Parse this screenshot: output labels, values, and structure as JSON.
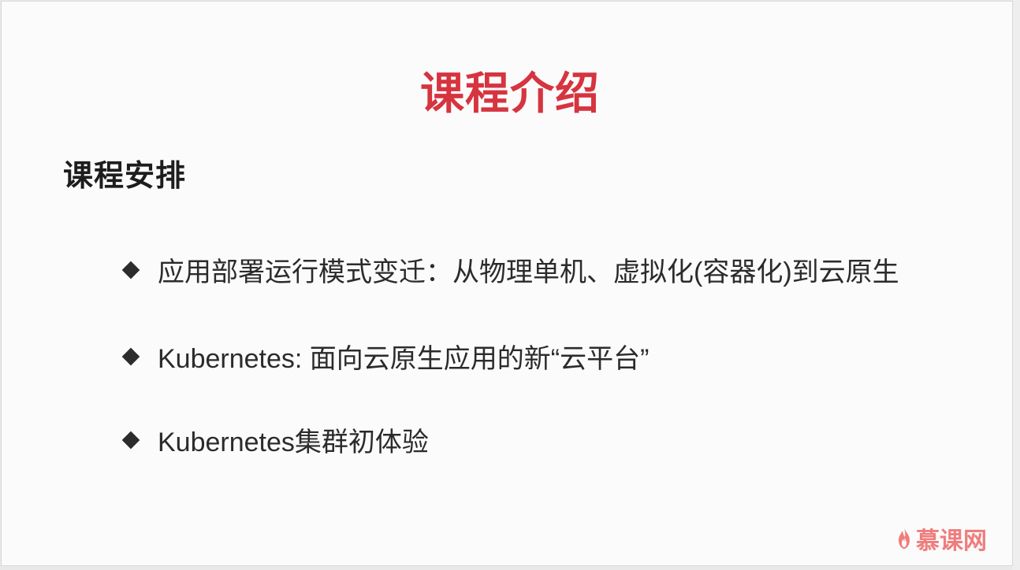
{
  "slide": {
    "title": "课程介绍",
    "section_title": "课程安排",
    "bullets": [
      "应用部署运行模式变迁：从物理单机、虚拟化(容器化)到云原生",
      "Kubernetes: 面向云原生应用的新“云平台”",
      "Kubernetes集群初体验"
    ]
  },
  "brand": {
    "name": "慕课网",
    "accent_color": "#f07d7d"
  },
  "colors": {
    "title": "#d6343f",
    "text": "#2b2b2b",
    "background": "#fbfbfb"
  }
}
